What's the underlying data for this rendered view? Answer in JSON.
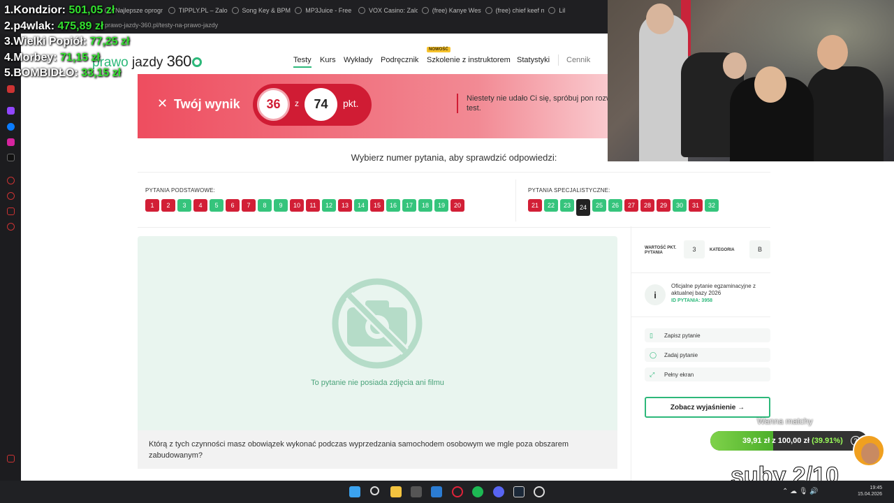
{
  "browser": {
    "tabs": [
      "Najlepsze oprogr",
      "TIPPLY.PL – Zalog",
      "Song Key & BPM",
      "MP3Juice - Free",
      "VOX Casino: Zalo",
      "(free) Kanye West",
      "(free) chief keef m",
      "Lil"
    ],
    "url": "prawo-jazdy-360.pl/testy-na-prawo-jazdy"
  },
  "leaderboard": [
    {
      "rank": "1.",
      "name": "Kondzior:",
      "amount": "501,05 zł"
    },
    {
      "rank": "2.",
      "name": "p4wlak:",
      "amount": "475,89 zł"
    },
    {
      "rank": "3.",
      "name": "Wielki Popiół:",
      "amount": "77,25 zł"
    },
    {
      "rank": "4.",
      "name": "Morbey:",
      "amount": "71,15 zł"
    },
    {
      "rank": "5.",
      "name": "BOMBIDŁO:",
      "amount": "33,15 zł"
    }
  ],
  "site": {
    "logo": {
      "part1": "prawo",
      "part2": "jazdy",
      "part3": "360"
    },
    "nav": {
      "testy": "Testy",
      "kurs": "Kurs",
      "wyklady": "Wykłady",
      "podrecznik": "Podręcznik",
      "szkolenie": "Szkolenie z instruktorem",
      "new_badge": "NOWOŚĆ",
      "statystyki": "Statystyki",
      "cennik": "Cennik"
    }
  },
  "result": {
    "title": "Twój wynik",
    "score": "36",
    "of": "z",
    "max": "74",
    "unit": "pkt.",
    "message": "Niestety nie udało Ci się, spróbuj pon rozwiązać test."
  },
  "questions": {
    "prompt": "Wybierz numer pytania, aby sprawdzić odpowiedzi:",
    "basic_title": "PYTANIA PODSTAWOWE:",
    "basic": [
      {
        "n": "1",
        "s": "red"
      },
      {
        "n": "2",
        "s": "red"
      },
      {
        "n": "3",
        "s": "green"
      },
      {
        "n": "4",
        "s": "red"
      },
      {
        "n": "5",
        "s": "green"
      },
      {
        "n": "6",
        "s": "red"
      },
      {
        "n": "7",
        "s": "red"
      },
      {
        "n": "8",
        "s": "green"
      },
      {
        "n": "9",
        "s": "green"
      },
      {
        "n": "10",
        "s": "red"
      },
      {
        "n": "11",
        "s": "red"
      },
      {
        "n": "12",
        "s": "green"
      },
      {
        "n": "13",
        "s": "red"
      },
      {
        "n": "14",
        "s": "green"
      },
      {
        "n": "15",
        "s": "red"
      },
      {
        "n": "16",
        "s": "green"
      },
      {
        "n": "17",
        "s": "green"
      },
      {
        "n": "18",
        "s": "green"
      },
      {
        "n": "19",
        "s": "green"
      },
      {
        "n": "20",
        "s": "red"
      }
    ],
    "special_title": "PYTANIA SPECJALISTYCZNE:",
    "special": [
      {
        "n": "21",
        "s": "red"
      },
      {
        "n": "22",
        "s": "green"
      },
      {
        "n": "23",
        "s": "green"
      },
      {
        "n": "24",
        "s": "cur"
      },
      {
        "n": "25",
        "s": "green"
      },
      {
        "n": "26",
        "s": "green"
      },
      {
        "n": "27",
        "s": "red"
      },
      {
        "n": "28",
        "s": "red"
      },
      {
        "n": "29",
        "s": "red"
      },
      {
        "n": "30",
        "s": "green"
      },
      {
        "n": "31",
        "s": "red"
      },
      {
        "n": "32",
        "s": "green"
      }
    ]
  },
  "media": {
    "caption": "To pytanie nie posiada zdjęcia ani filmu"
  },
  "question_text": "Którą z tych czynności masz obowiązek wykonać podczas wyprzedzania samochodem osobowym we mgle poza obszarem zabudowanym?",
  "sidebar": {
    "points_label": "WARTOŚĆ PKT. PYTANIA",
    "points_value": "3",
    "category_label": "KATEGORIA",
    "category_value": "B",
    "info_text": "Oficjalne pytanie egzaminacyjne z aktualnej bazy 2026",
    "info_id": "ID PYTANIA: 3958",
    "save": "Zapisz pytanie",
    "ask": "Zadaj pytanie",
    "fullscreen": "Pełny ekran",
    "explain": "Zobacz wyjaśnienie →"
  },
  "goal": {
    "title": "Wanna matchy",
    "current": "39,91 zł",
    "of": "z",
    "target": "100,00 zł",
    "percent": "(39.91%)",
    "progress": 0.3991
  },
  "subs_text": "suby 2/10",
  "clock": {
    "time": "19:45",
    "date": "15.04.2026"
  }
}
